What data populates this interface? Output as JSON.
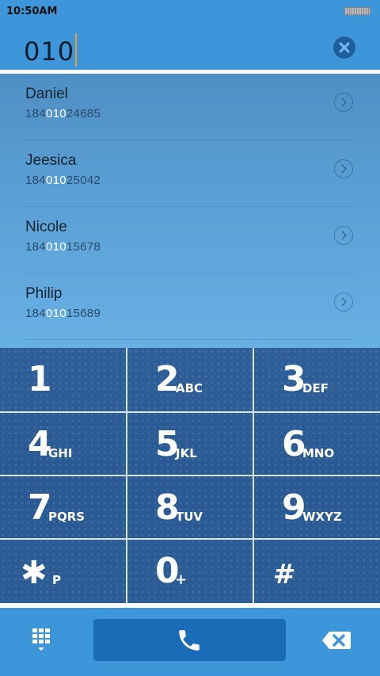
{
  "status_bar": {
    "time": "10:50AM"
  },
  "entry": {
    "number": "010"
  },
  "contacts": [
    {
      "name": "Daniel",
      "number_pre": "184",
      "number_match": "010",
      "number_post": "24685"
    },
    {
      "name": "Jeesica",
      "number_pre": "184",
      "number_match": "010",
      "number_post": "25042"
    },
    {
      "name": "Nicole",
      "number_pre": "184",
      "number_match": "010",
      "number_post": "15678"
    },
    {
      "name": "Philip",
      "number_pre": "184",
      "number_match": "010",
      "number_post": "15689"
    }
  ],
  "keys": [
    {
      "digit": "1",
      "letters": ""
    },
    {
      "digit": "2",
      "letters": "ABC"
    },
    {
      "digit": "3",
      "letters": "DEF"
    },
    {
      "digit": "4",
      "letters": "GHI"
    },
    {
      "digit": "5",
      "letters": "JKL"
    },
    {
      "digit": "6",
      "letters": "MNO"
    },
    {
      "digit": "7",
      "letters": "PQRS"
    },
    {
      "digit": "8",
      "letters": "TUV"
    },
    {
      "digit": "9",
      "letters": "WXYZ"
    },
    {
      "digit": "✱",
      "letters": "P"
    },
    {
      "digit": "0",
      "letters": "+"
    },
    {
      "digit": "#",
      "letters": ""
    }
  ],
  "icons": {
    "clear": "clear-circle-icon",
    "chevron": "chevron-right-circle-icon",
    "keypad": "keypad-grid-icon",
    "call": "phone-icon",
    "backspace": "backspace-icon"
  },
  "colors": {
    "header": "#3c96d9",
    "highlight": "#ffffff",
    "dialpad": "#2a5a93",
    "call_button": "#1b6cb6"
  }
}
